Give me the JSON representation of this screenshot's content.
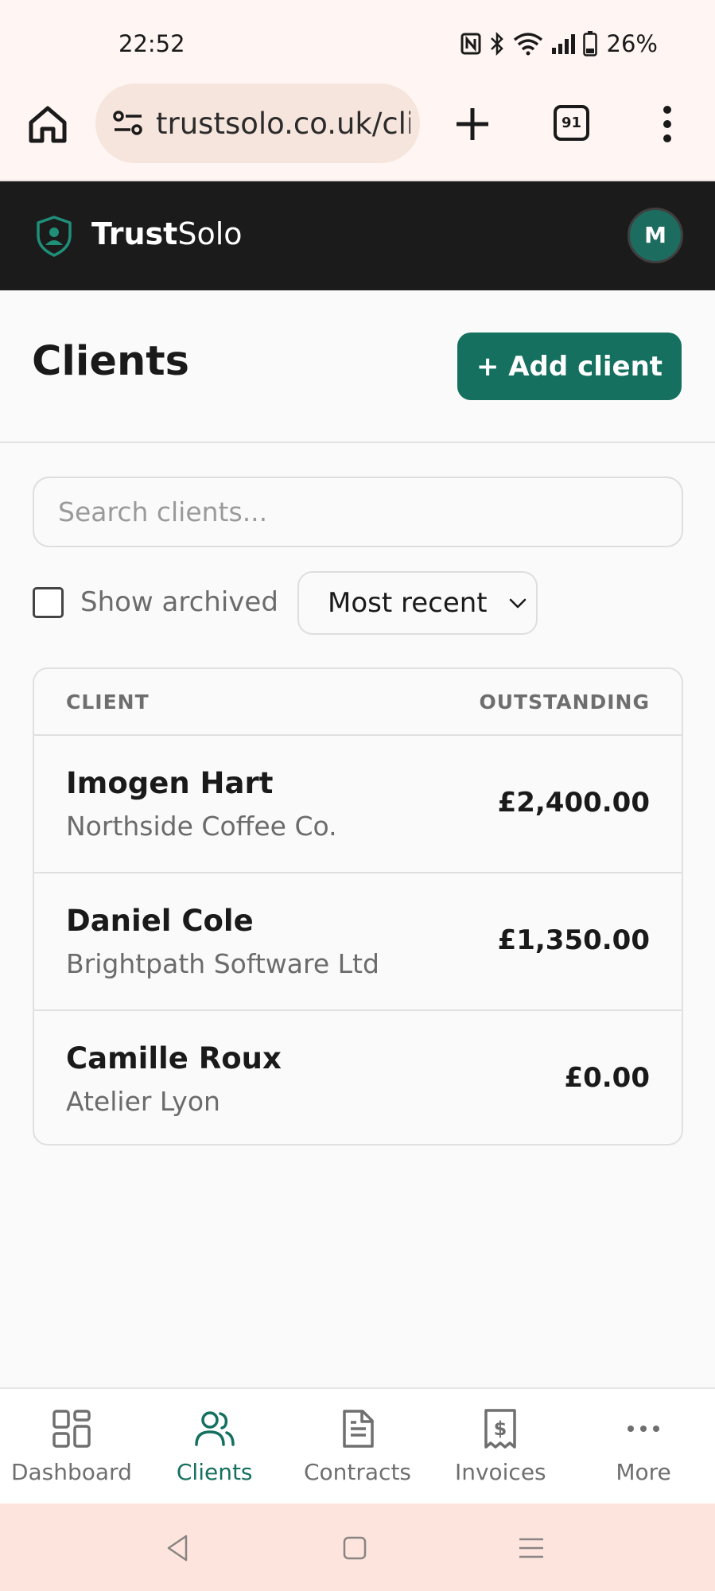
{
  "status_bar": {
    "time": "22:52",
    "battery": "26%"
  },
  "browser": {
    "url": "trustsolo.co.uk/clients",
    "tab_count": "91"
  },
  "header": {
    "brand_bold": "Trust",
    "brand_light": "Solo",
    "avatar_initial": "M"
  },
  "page": {
    "title": "Clients",
    "add_button": "+ Add client"
  },
  "search": {
    "placeholder": "Search clients..."
  },
  "filters": {
    "show_archived_label": "Show archived",
    "show_archived_checked": false,
    "sort_selected": "Most recent"
  },
  "table": {
    "col_client": "CLIENT",
    "col_outstanding": "OUTSTANDING",
    "rows": [
      {
        "name": "Imogen Hart",
        "company": "Northside Coffee Co.",
        "outstanding": "£2,400.00"
      },
      {
        "name": "Daniel Cole",
        "company": "Brightpath Software Ltd",
        "outstanding": "£1,350.00"
      },
      {
        "name": "Camille Roux",
        "company": "Atelier Lyon",
        "outstanding": "£0.00"
      }
    ]
  },
  "bottom_nav": {
    "items": [
      {
        "label": "Dashboard",
        "icon": "dashboard-icon",
        "active": false
      },
      {
        "label": "Clients",
        "icon": "clients-icon",
        "active": true
      },
      {
        "label": "Contracts",
        "icon": "contracts-icon",
        "active": false
      },
      {
        "label": "Invoices",
        "icon": "invoices-icon",
        "active": false
      },
      {
        "label": "More",
        "icon": "more-icon",
        "active": false
      }
    ]
  },
  "colors": {
    "accent": "#15705f",
    "header_bg": "#1b1b1b",
    "status_bar_bg": "#fff5f2"
  }
}
